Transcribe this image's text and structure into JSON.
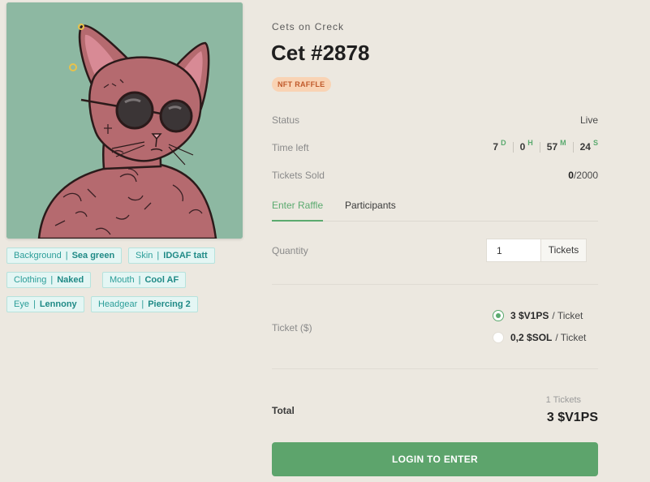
{
  "collection": "Cets on Creck",
  "title": "Cet #2878",
  "badge": "NFT RAFFLE",
  "traits": [
    {
      "label": "Background",
      "value": "Sea green"
    },
    {
      "label": "Skin",
      "value": "IDGAF tatt"
    },
    {
      "label": "Clothing",
      "value": "Naked"
    },
    {
      "label": "Mouth",
      "value": "Cool AF"
    },
    {
      "label": "Eye",
      "value": "Lennony"
    },
    {
      "label": "Headgear",
      "value": "Piercing 2"
    }
  ],
  "status": {
    "label": "Status",
    "value": "Live"
  },
  "time_left": {
    "label": "Time left",
    "days": "7",
    "days_unit": "D",
    "hours": "0",
    "hours_unit": "H",
    "minutes": "57",
    "minutes_unit": "M",
    "seconds": "24",
    "seconds_unit": "S"
  },
  "tickets_sold": {
    "label": "Tickets Sold",
    "sold": "0",
    "total": "/2000"
  },
  "tabs": [
    {
      "label": "Enter Raffle",
      "active": true
    },
    {
      "label": "Participants",
      "active": false
    }
  ],
  "quantity": {
    "label": "Quantity",
    "value": "1",
    "unit": "Tickets"
  },
  "ticket_price": {
    "label": "Ticket ($)",
    "options": [
      {
        "amount": "3 $V1PS",
        "suffix": "/ Ticket",
        "selected": true
      },
      {
        "amount": "0,2 $SOL",
        "suffix": "/ Ticket",
        "selected": false
      }
    ]
  },
  "total": {
    "label": "Total",
    "count": "1 Tickets",
    "value": "3 $V1PS"
  },
  "login_button": "LOGIN TO ENTER",
  "colors": {
    "accent": "#5DA46C",
    "background": "#ECE8E0",
    "art_bg": "#8DB8A2",
    "badge_bg": "#F9D3B4",
    "badge_text": "#C0592A",
    "trait_text": "#2A9D98"
  }
}
